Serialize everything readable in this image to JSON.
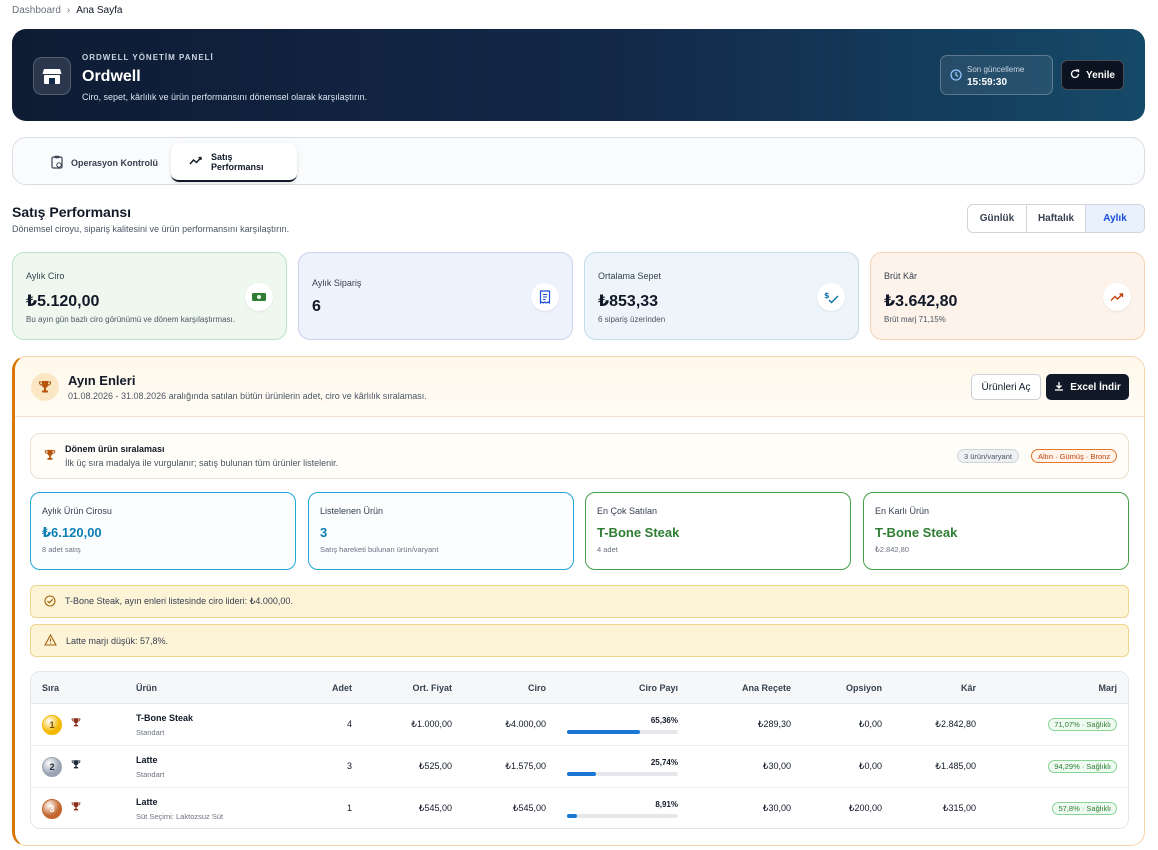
{
  "breadcrumb": {
    "root": "Dashboard",
    "current": "Ana Sayfa"
  },
  "hero": {
    "kicker": "ORDWELL YÖNETİM PANELİ",
    "title": "Ordwell",
    "desc": "Ciro, sepet, kârlılık ve ürün performansını dönemsel olarak karşılaştırın.",
    "update_label": "Son güncelleme",
    "update_time": "15:59:30",
    "refresh": "Yenile"
  },
  "tabs": [
    {
      "label": "Operasyon Kontrolü"
    },
    {
      "label": "Satış Performansı"
    }
  ],
  "section": {
    "title": "Satış Performansı",
    "subtitle": "Dönemsel ciroyu, sipariş kalitesini ve ürün performansını karşılaştırın.",
    "periods": [
      "Günlük",
      "Haftalık",
      "Aylık"
    ]
  },
  "kpis": [
    {
      "label": "Aylık Ciro",
      "value": "₺5.120,00",
      "note": "Bu ayın gün bazlı ciro görünümü ve dönem karşılaştırması."
    },
    {
      "label": "Aylık Sipariş",
      "value": "6",
      "note": ""
    },
    {
      "label": "Ortalama Sepet",
      "value": "₺853,33",
      "note": "6 sipariş üzerinden"
    },
    {
      "label": "Brüt Kâr",
      "value": "₺3.642,80",
      "note": "Brüt marj 71,15%"
    }
  ],
  "panel": {
    "title": "Ayın Enleri",
    "subtitle": "01.08.2026 - 31.08.2026 aralığında satılan bütün ürünlerin adet, ciro ve kârlılık sıralaması.",
    "open_btn": "Ürünleri Aç",
    "excel_btn": "Excel İndir",
    "rank": {
      "title": "Dönem ürün sıralaması",
      "subtitle": "İlk üç sıra madalya ile vurgulanır; satış bulunan tüm ürünler listelenir.",
      "count_pill": "3 ürün/varyant",
      "medal_pill": "Altın · Gümüş · Bronz"
    },
    "mini": [
      {
        "label": "Aylık Ürün Cirosu",
        "value": "₺6.120,00",
        "note": "8 adet satış"
      },
      {
        "label": "Listelenen Ürün",
        "value": "3",
        "note": "Satış hareketi bulunan ürün/varyant"
      },
      {
        "label": "En Çok Satılan",
        "value": "T-Bone Steak",
        "note": "4 adet"
      },
      {
        "label": "En Karlı Ürün",
        "value": "T-Bone Steak",
        "note": "₺2.842,80"
      }
    ],
    "alerts": [
      "T-Bone Steak, ayın enleri listesinde ciro lideri: ₺4.000,00.",
      "Latte marjı düşük: 57,8%."
    ],
    "table": {
      "headers": [
        "Sıra",
        "Ürün",
        "Adet",
        "Ort. Fiyat",
        "Ciro",
        "Ciro Payı",
        "Ana Reçete",
        "Opsiyon",
        "Kâr",
        "Marj"
      ],
      "rows": [
        {
          "rank": "1",
          "name": "T-Bone Steak",
          "variant": "Standart",
          "qty": "4",
          "avg": "₺1.000,00",
          "revenue": "₺4.000,00",
          "share": "65,36%",
          "share_value": 65.36,
          "recipe": "₺289,30",
          "option": "₺0,00",
          "profit": "₺2.842,80",
          "margin": "71,07% · Sağlıklı"
        },
        {
          "rank": "2",
          "name": "Latte",
          "variant": "Standart",
          "qty": "3",
          "avg": "₺525,00",
          "revenue": "₺1.575,00",
          "share": "25,74%",
          "share_value": 25.74,
          "recipe": "₺30,00",
          "option": "₺0,00",
          "profit": "₺1.485,00",
          "margin": "94,29% · Sağlıklı"
        },
        {
          "rank": "3",
          "name": "Latte",
          "variant": "Süt Seçimi: Laktozsuz Süt",
          "qty": "1",
          "avg": "₺545,00",
          "revenue": "₺545,00",
          "share": "8,91%",
          "share_value": 8.91,
          "recipe": "₺30,00",
          "option": "₺200,00",
          "profit": "₺315,00",
          "margin": "57,8% · Sağlıklı"
        }
      ]
    }
  },
  "colors": {
    "accent": "#1976d2",
    "gold": "#f5b800",
    "silver": "#9aa5b4",
    "bronze": "#c2652a",
    "hero_bg": "#13294a"
  }
}
